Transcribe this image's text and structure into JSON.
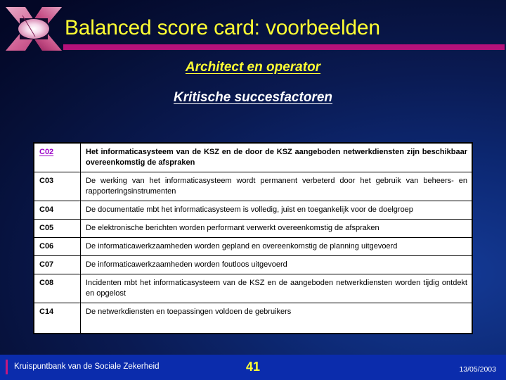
{
  "slide": {
    "title": "Balanced score card: voorbeelden",
    "subtitle_1": "Architect en operator",
    "subtitle_2": "Kritische succesfactoren",
    "logo_name": "kruispuntbank-x-logo",
    "colors": {
      "title_yellow": "#ffff33",
      "rule_magenta": "#b5117a",
      "background_navy": "#0a1a52",
      "footer_blue": "#0b2cac",
      "code_link_purple": "#9b00c8"
    }
  },
  "table": {
    "rows": [
      {
        "code": "C02",
        "code_is_link": true,
        "bold": true,
        "text": "Het informaticasysteem van de KSZ en de door de KSZ aangeboden netwerkdiensten zijn beschikbaar overeenkomstig de afspraken"
      },
      {
        "code": "C03",
        "code_is_link": false,
        "bold": false,
        "text": "De werking van het informaticasysteem wordt permanent verbeterd door het gebruik van beheers- en rapporteringsinstrumenten"
      },
      {
        "code": "C04",
        "code_is_link": false,
        "bold": false,
        "text": "De documentatie mbt het informaticasysteem is volledig, juist en toegankelijk voor de doelgroep"
      },
      {
        "code": "C05",
        "code_is_link": false,
        "bold": false,
        "text": "De elektronische berichten worden performant verwerkt overeenkomstig de afspraken"
      },
      {
        "code": "C06",
        "code_is_link": false,
        "bold": false,
        "text": "De informaticawerkzaamheden worden gepland en overeenkomstig de planning uitgevoerd"
      },
      {
        "code": "C07",
        "code_is_link": false,
        "bold": false,
        "text": "De informaticawerkzaamheden worden foutloos uitgevoerd"
      },
      {
        "code": "C08",
        "code_is_link": false,
        "bold": false,
        "text": "Incidenten mbt het informaticasysteem van de KSZ en de aangeboden netwerkdiensten worden tijdig ontdekt en opgelost"
      },
      {
        "code": "C14",
        "code_is_link": false,
        "bold": false,
        "tall": true,
        "text": "De netwerkdiensten en toepassingen voldoen de gebruikers"
      }
    ]
  },
  "footer": {
    "organisation": "Kruispuntbank van de Sociale Zekerheid",
    "page_number": "41",
    "date": "13/05/2003"
  }
}
